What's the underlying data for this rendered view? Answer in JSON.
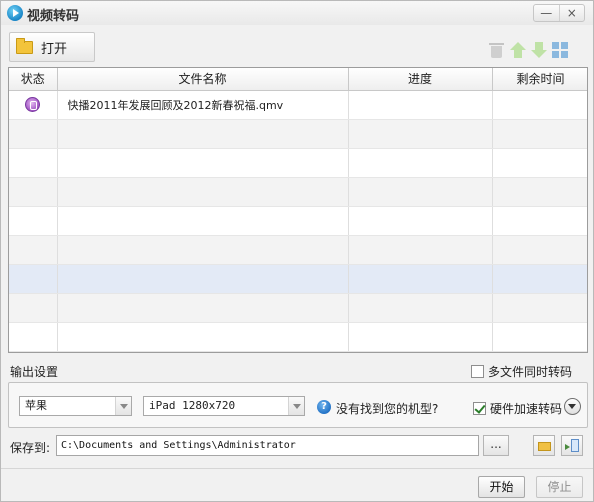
{
  "window": {
    "title": "视频转码",
    "minimize_label": "—",
    "close_label": "×"
  },
  "toolbar": {
    "open_label": "打开",
    "icons": [
      "trash-icon",
      "move-up-icon",
      "move-down-icon",
      "grid-view-icon"
    ]
  },
  "table": {
    "headers": [
      "状态",
      "文件名称",
      "进度",
      "剩余时间"
    ],
    "rows": [
      {
        "status_icon": "converting-status-icon",
        "filename": "快播2011年发展回顾及2012新春祝福.qmv",
        "progress": "",
        "remaining": ""
      }
    ]
  },
  "output": {
    "label": "输出设置",
    "multi_file_label": "多文件同时转码",
    "multi_file_checked": false,
    "brand_value": "苹果",
    "model_value": "iPad 1280x720",
    "help_icon_glyph": "?",
    "help_text": "没有找到您的机型?",
    "hw_accel_label": "硬件加速转码",
    "hw_accel_checked": true
  },
  "save": {
    "label": "保存到:",
    "path": "C:\\Documents and Settings\\Administrator",
    "browse_label": "..."
  },
  "actions": {
    "start_label": "开始",
    "stop_label": "停止"
  },
  "colors": {
    "selected_row": "#e3eaf6",
    "alt_row": "#f3f3f3",
    "status_purple": "#9b4cc0"
  }
}
